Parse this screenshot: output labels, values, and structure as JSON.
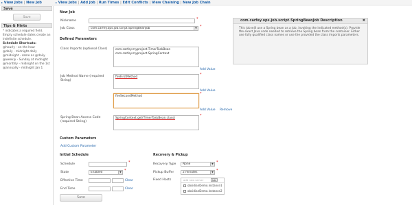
{
  "nav": {
    "left": [
      "View Jobs",
      "New Job"
    ],
    "right": [
      "View Jobs",
      "Add Job",
      "Run Times",
      "Edit Conflicts",
      "View Chaining",
      "New Job Chain"
    ],
    "separator": "|"
  },
  "sidebar": {
    "save_title": "Save",
    "save_button": "Save",
    "tips_title": "Tips & Hints",
    "required_note": "* indicates a required field.",
    "empty_note_1": "Empty schedule dates create an",
    "empty_note_2": "indefinite schedule.",
    "shortcuts_title": "Schedule Shortcuts:",
    "shortcuts": [
      "@hourly - on the hour",
      "@daily - midnight daily",
      "@midnight - same as @daily",
      "@weekly - Sunday at midnight",
      "@monthly - midnight on the 1st",
      "@annually - midnight Jan 1"
    ]
  },
  "form": {
    "title": "New Job",
    "nickname_label": "Nickname",
    "nickname_value": "",
    "job_class_label": "Job Class",
    "job_class_value": "com.carfey.ops.job.script.SpringBeanJob",
    "defined_params_title": "Defined Parameters",
    "class_imports_label": "Class Imports (optional Class)",
    "class_imports_lines": [
      "com.carfey.myproject.TimerTaskBean",
      "com.carfey.myproject.SpringContext"
    ],
    "add_value": "Add Value",
    "remove": "Remove",
    "job_method_label_1": "Job Method Name (required",
    "job_method_label_2": "String)",
    "job_method_value_1": "fireFirstMethod",
    "job_method_value_2": "fireSecondMethod",
    "spring_bean_label_1": "Spring Bean Access Code",
    "spring_bean_label_2": "(required String)",
    "spring_bean_value": "SpringContext.get(TimerTaskBean.class)",
    "custom_params_title": "Custom Parameters",
    "add_custom_param": "Add Custom Parameter",
    "initial_schedule_title": "Initial Schedule",
    "schedule_label": "Schedule",
    "schedule_value": "",
    "state_label": "State",
    "state_value": "Enabled",
    "effective_time_label": "Effective Time",
    "end_time_label": "End Time",
    "clear": "Clear",
    "recovery_title": "Recovery & Pickup",
    "recovery_type_label": "Recovery Type",
    "recovery_type_value": "None",
    "pickup_buffer_label": "Pickup Buffer",
    "pickup_buffer_value": "2 minutes",
    "fixed_hosts_label": "Fixed Hosts",
    "host_input_placeholder": "add new server",
    "host_add": "Add",
    "hosts": [
      "obsidianDemo.instance1",
      "obsidianDemo.instance2"
    ],
    "save_button": "Save"
  },
  "description": {
    "title": "com.carfey.ops.job.script.SpringBeanJob Description",
    "close": "✖",
    "body": "This job will use a Spring bean as a job, invoking the indicated method(s). Provide the exact Java code needed to retrieve the Spring bean from the container. Either use fully qualified class names or use the provided the class imports parameters."
  },
  "colors": {
    "link": "#1a5fa8",
    "required": "#dd0000",
    "focus": "#e0a050"
  }
}
